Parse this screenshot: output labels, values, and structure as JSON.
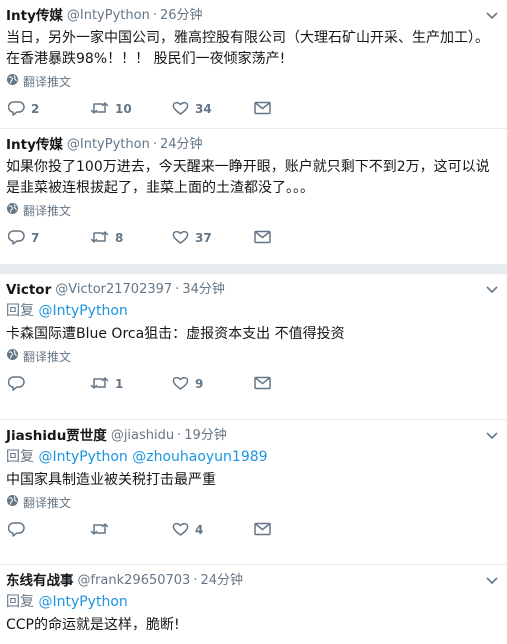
{
  "ui": {
    "translate_label": "翻译推文",
    "reply_prefix": "回复",
    "dot": "·"
  },
  "tweets": [
    {
      "name": "Inty传媒",
      "handle": "@IntyPython",
      "time": "26分钟",
      "text": "当日，另外一家中国公司，雅高控股有限公司（大理石矿山开采、生产加工）。在香港暴跌98%！！！  股民们一夜倾家荡产!",
      "replies": "2",
      "retweets": "10",
      "likes": "34"
    },
    {
      "name": "Inty传媒",
      "handle": "@IntyPython",
      "time": "24分钟",
      "text": "如果你投了100万进去，今天醒来一睁开眼，账户就只剩下不到2万，这可以说是韭菜被连根拔起了，韭菜上面的土渣都没了。。。",
      "replies": "7",
      "retweets": "8",
      "likes": "37"
    },
    {
      "name": "Victor",
      "handle": "@Victor21702397",
      "time": "34分钟",
      "mentions": [
        "@IntyPython"
      ],
      "text": "卡森国际遭Blue Orca狙击：虚报资本支出 不值得投资",
      "replies": "",
      "retweets": "1",
      "likes": "9"
    },
    {
      "name": "Jiashidu贾世度",
      "handle": "@jiashidu",
      "time": "19分钟",
      "mentions": [
        "@IntyPython",
        "@zhouhaoyun1989"
      ],
      "text": "中国家具制造业被关税打击最严重",
      "replies": "",
      "retweets": "",
      "likes": "4"
    },
    {
      "name": "东线有战事",
      "handle": "@frank29650703",
      "time": "24分钟",
      "mentions": [
        "@IntyPython"
      ],
      "text": "CCP的命运就是这样，脆断!"
    }
  ],
  "colors": {
    "text": "#14171a",
    "muted": "#657786",
    "link": "#1b95e0",
    "divider": "#e6ecf0"
  }
}
